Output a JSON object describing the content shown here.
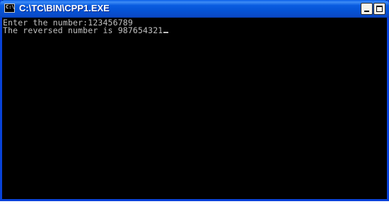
{
  "window": {
    "title": "C:\\TC\\BIN\\CPP1.EXE",
    "app_icon_text": "C:\\"
  },
  "controls": {
    "minimize_label": "_",
    "maximize_label": "",
    "close_label": "×"
  },
  "console": {
    "lines": [
      "Enter the number:123456789",
      "The reversed number is 987654321"
    ],
    "cursor": "_"
  },
  "colors": {
    "titlebar": "#0553d6",
    "console_background": "#000000",
    "console_text": "#c0c0c0"
  }
}
